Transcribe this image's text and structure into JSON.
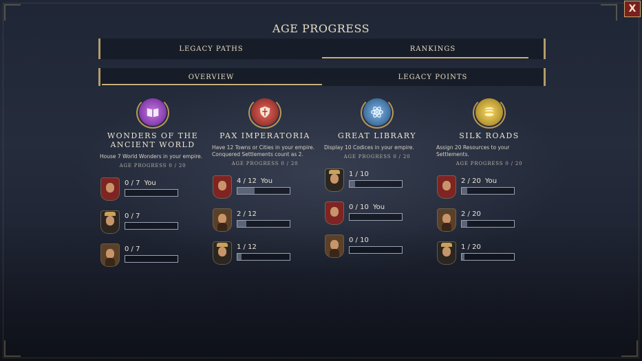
{
  "title": "AGE PROGRESS",
  "close_label": "X",
  "tabs": [
    {
      "label": "LEGACY PATHS",
      "active": false
    },
    {
      "label": "RANKINGS",
      "active": true
    }
  ],
  "subtabs": [
    {
      "label": "OVERVIEW",
      "active": true
    },
    {
      "label": "LEGACY POINTS",
      "active": false
    }
  ],
  "columns": [
    {
      "name": "WONDERS OF THE ANCIENT WORLD",
      "emblem_icon": "book-icon",
      "emblem_color": "#8e3ab3",
      "description": "House 7 World Wonders in your empire.",
      "age_progress": "AGE PROGRESS  0 / 20",
      "rows": [
        {
          "text": "0 / 7",
          "you": "You",
          "progress": 0.0,
          "portrait": "red"
        },
        {
          "text": "0 / 7",
          "you": "",
          "progress": 0.0,
          "portrait": "dark"
        },
        {
          "text": "0 / 7",
          "you": "",
          "progress": 0.0,
          "portrait": "brown"
        }
      ]
    },
    {
      "name": "PAX IMPERATORIA",
      "emblem_icon": "shield-icon",
      "emblem_color": "#b8322c",
      "description": "Have 12 Towns or Cities in your empire. Conquered Settlements count as 2.",
      "age_progress": "AGE PROGRESS  0 / 20",
      "rows": [
        {
          "text": "4 / 12",
          "you": "You",
          "progress": 0.333,
          "portrait": "red"
        },
        {
          "text": "2 / 12",
          "you": "",
          "progress": 0.167,
          "portrait": "brown"
        },
        {
          "text": "1 / 12",
          "you": "",
          "progress": 0.083,
          "portrait": "dark"
        }
      ]
    },
    {
      "name": "GREAT LIBRARY",
      "emblem_icon": "atom-icon",
      "emblem_color": "#3f78b3",
      "description": "Display 10 Codices in your empire.",
      "age_progress": "AGE PROGRESS  0 / 20",
      "rows": [
        {
          "text": "1 / 10",
          "you": "",
          "progress": 0.1,
          "portrait": "dark"
        },
        {
          "text": "0 / 10",
          "you": "You",
          "progress": 0.0,
          "portrait": "red"
        },
        {
          "text": "0 / 10",
          "you": "",
          "progress": 0.0,
          "portrait": "brown"
        }
      ]
    },
    {
      "name": "SILK ROADS",
      "emblem_icon": "coins-icon",
      "emblem_color": "#d9b23a",
      "description": "Assign 20 Resources to your Settlements.",
      "age_progress": "AGE PROGRESS  0 / 20",
      "rows": [
        {
          "text": "2 / 20",
          "you": "You",
          "progress": 0.1,
          "portrait": "red"
        },
        {
          "text": "2 / 20",
          "you": "",
          "progress": 0.1,
          "portrait": "brown"
        },
        {
          "text": "1 / 20",
          "you": "",
          "progress": 0.05,
          "portrait": "dark"
        }
      ]
    }
  ]
}
